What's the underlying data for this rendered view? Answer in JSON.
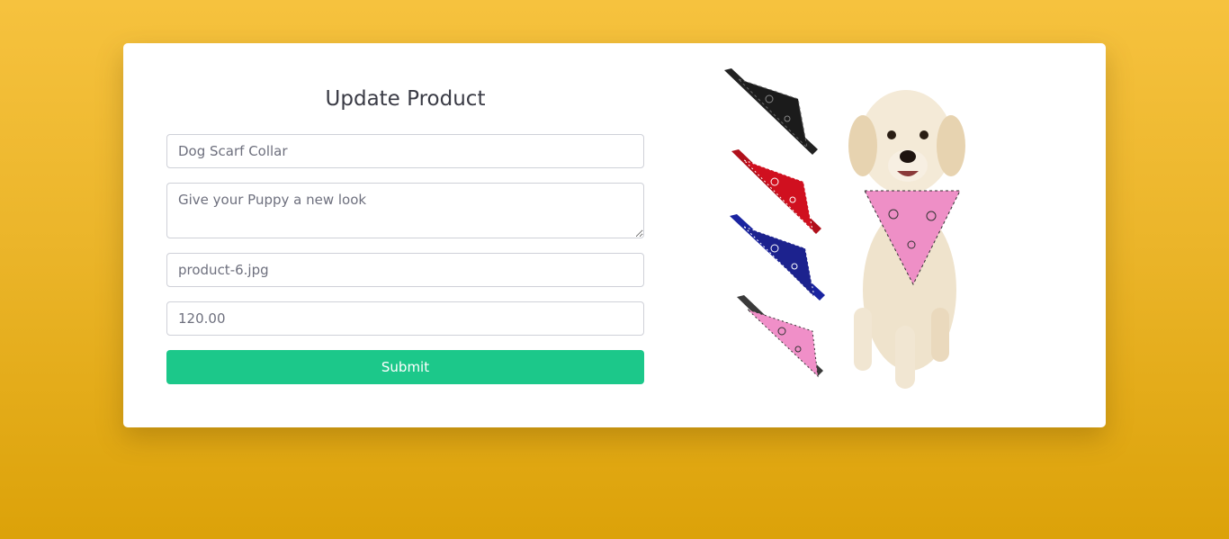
{
  "form": {
    "title": "Update Product",
    "name_value": "Dog Scarf Collar",
    "description_value": "Give your Puppy a new look",
    "image_value": "product-6.jpg",
    "price_value": "120.00",
    "submit_label": "Submit"
  },
  "colors": {
    "background_top": "#f6c23e",
    "background_bottom": "#dca209",
    "submit": "#1cc88a"
  }
}
